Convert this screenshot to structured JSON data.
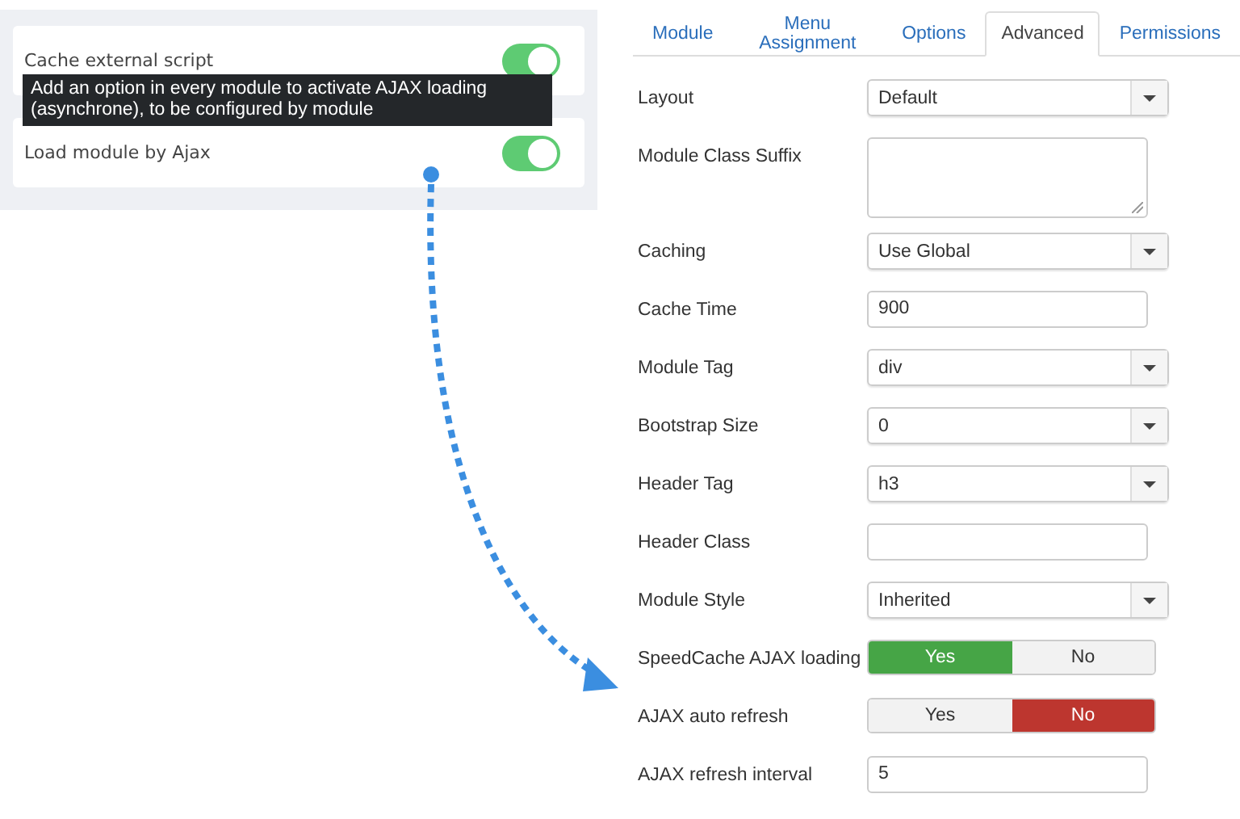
{
  "settings_panel": {
    "items": [
      {
        "label": "Cache external script",
        "on": true
      },
      {
        "label": "Load module by Ajax",
        "on": true
      }
    ],
    "tooltip": "Add an option in every module to activate AJAX loading (asynchrone), to be configured by module"
  },
  "tabs": [
    {
      "label": "Module",
      "selected": false
    },
    {
      "label": "Menu Assignment",
      "selected": false
    },
    {
      "label": "Options",
      "selected": false
    },
    {
      "label": "Advanced",
      "selected": true
    },
    {
      "label": "Permissions",
      "selected": false
    }
  ],
  "fields": [
    {
      "label": "Layout",
      "kind": "select",
      "value": "Default"
    },
    {
      "label": "Module Class Suffix",
      "kind": "textarea"
    },
    {
      "label": "Caching",
      "kind": "select",
      "value": "Use Global"
    },
    {
      "label": "Cache Time",
      "kind": "text",
      "value": "900"
    },
    {
      "label": "Module Tag",
      "kind": "select",
      "value": "div"
    },
    {
      "label": "Bootstrap Size",
      "kind": "select",
      "value": "0"
    },
    {
      "label": "Header Tag",
      "kind": "select",
      "value": "h3"
    },
    {
      "label": "Header Class",
      "kind": "text"
    },
    {
      "label": "Module Style",
      "kind": "select",
      "value": "Inherited"
    },
    {
      "label": "SpeedCache AJAX loading",
      "kind": "toggle",
      "options": [
        {
          "label": "Yes",
          "selected": true
        },
        {
          "label": "No",
          "selected": false
        }
      ]
    },
    {
      "label": "AJAX auto refresh",
      "kind": "toggle",
      "options": [
        {
          "label": "Yes",
          "selected": false
        },
        {
          "label": "No",
          "selected": true
        }
      ]
    },
    {
      "label": "AJAX refresh interval",
      "kind": "text",
      "value": "5"
    }
  ]
}
